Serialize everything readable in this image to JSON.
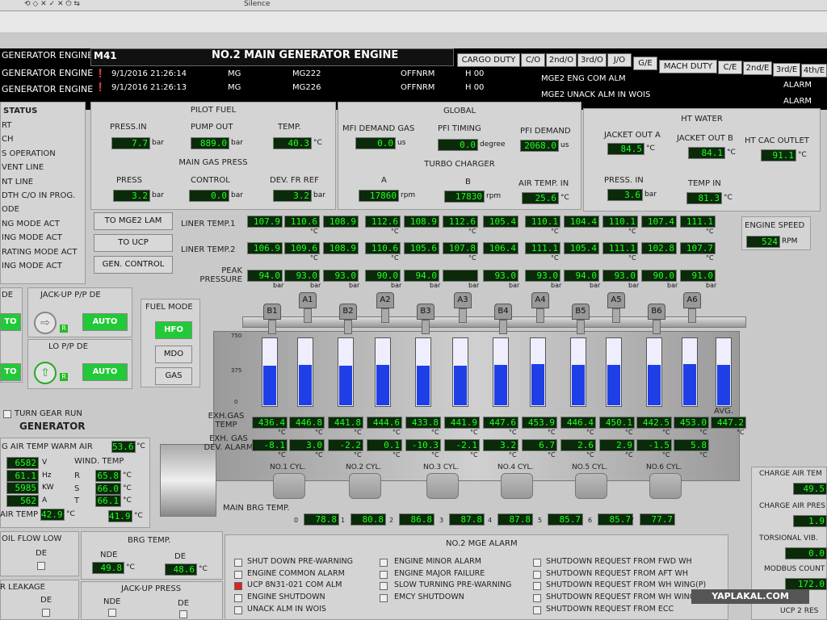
{
  "toolbar": {
    "silence": "Silence"
  },
  "header": {
    "engine_id": "M41",
    "title": "NO.2 MAIN GENERATOR ENGINE",
    "left_rows": [
      "GENERATOR ENGINE",
      "GENERATOR ENGINE",
      "GENERATOR ENGINE"
    ],
    "alarms": [
      {
        "time": "9/1/2016 21:26:14",
        "grp": "MG",
        "tag": "MG222",
        "state": "OFFNRM",
        "h": "H 00",
        "msg": "MGE2 ENG COM ALM",
        "status": "ALARM"
      },
      {
        "time": "9/1/2016 21:26:13",
        "grp": "MG",
        "tag": "MG226",
        "state": "OFFNRM",
        "h": "H 00",
        "msg": "MGE2 UNACK ALM IN WOIS",
        "status": "ALARM"
      }
    ],
    "tabs1": [
      "CARGO DUTY",
      "C/O",
      "2nd/O",
      "3rd/O",
      "J/O",
      "G/E"
    ],
    "tabs2": [
      "MACH DUTY",
      "C/E",
      "2nd/E",
      "3rd/E",
      "4th/E"
    ]
  },
  "left": {
    "status_title": "STATUS",
    "items": [
      "RT",
      "CH",
      "S OPERATION",
      "VENT LINE",
      "NT LINE",
      "DTH C/O IN PROG.",
      "ODE",
      "NG MODE ACT",
      "ING MODE ACT",
      "RATING MODE ACT",
      "ING MODE ACT"
    ],
    "de": "DE",
    "jackup_title": "JACK-UP P/P DE",
    "lo_title": "LO P/P DE",
    "auto": "AUTO",
    "to": "TO",
    "r": "R",
    "turn_gear": "TURN GEAR RUN",
    "generator": "GENERATOR",
    "air_temp_warm": "G AIR TEMP WARM AIR",
    "air_temp_warm_val": "53.6",
    "gen_vals": [
      {
        "v": "6582",
        "u": "V"
      },
      {
        "v": "61.1",
        "u": "Hz"
      },
      {
        "v": "5985",
        "u": "KW"
      },
      {
        "v": "562",
        "u": "A"
      }
    ],
    "wind_title": "WIND. TEMP",
    "wind": [
      {
        "p": "R",
        "v": "65.8"
      },
      {
        "p": "S",
        "v": "66.0"
      },
      {
        "p": "T",
        "v": "66.1"
      }
    ],
    "air_temp": "AIR TEMP",
    "air_temp_a": "42.9",
    "air_temp_b": "41.9",
    "oil_flow": "OIL FLOW LOW",
    "brg_temp": "BRG TEMP.",
    "nde": "NDE",
    "brg_nde": "49.8",
    "brg_de": "48.6",
    "leakage": "R LEAKAGE",
    "jackup_press": "JACK-UP PRESS",
    "c": "°C"
  },
  "pilot": {
    "title": "PILOT FUEL",
    "press_lbl": "PRESS.IN",
    "press": "7.7",
    "pump_lbl": "PUMP OUT",
    "pump": "889.0",
    "temp_lbl": "TEMP.",
    "temp": "40.3",
    "gas_title": "MAIN GAS PRESS",
    "gpress_lbl": "PRESS",
    "gpress": "3.2",
    "ctrl_lbl": "CONTROL",
    "ctrl": "0.0",
    "dev_lbl": "DEV. FR REF",
    "dev": "3.2",
    "bar": "bar",
    "c": "°C"
  },
  "global": {
    "title": "GLOBAL",
    "mfi_lbl": "MFI DEMAND GAS",
    "mfi": "0.0",
    "us": "us",
    "pfi_lbl": "PFI TIMING",
    "pfi": "0.0",
    "degree": "degree",
    "pfid_lbl": "PFI DEMAND",
    "pfid": "2068.0",
    "tc_title": "TURBO CHARGER",
    "a_lbl": "A",
    "a": "17860",
    "b_lbl": "B",
    "b": "17830",
    "rpm": "rpm",
    "air_lbl": "AIR TEMP. IN",
    "air": "25.6"
  },
  "ht": {
    "title": "HT WATER",
    "ja_lbl": "JACKET OUT A",
    "ja": "84.5",
    "jb_lbl": "JACKET OUT B",
    "jb": "84.1",
    "cac_lbl": "HT CAC OUTLET",
    "cac": "91.1",
    "press_lbl": "PRESS. IN",
    "press": "3.6",
    "tin_lbl": "TEMP IN",
    "tin": "81.3"
  },
  "ctrl_buttons": [
    "TO MGE2 LAM",
    "TO UCP",
    "GEN. CONTROL"
  ],
  "fuel": {
    "title": "FUEL MODE",
    "modes": [
      "HFO",
      "MDO",
      "GAS"
    ]
  },
  "engine_speed": {
    "title": "ENGINE SPEED",
    "value": "524",
    "unit": "RPM"
  },
  "liner": {
    "l1": "LINER TEMP.1",
    "l2": "LINER TEMP.2",
    "pk": "PEAK PRESSURE",
    "t1": [
      "107.9",
      "110.6",
      "108.9",
      "112.6",
      "108.9",
      "112.6",
      "105.4",
      "110.1",
      "104.4",
      "110.1",
      "107.4",
      "111.1"
    ],
    "t2": [
      "106.9",
      "109.6",
      "108.9",
      "110.6",
      "105.6",
      "107.8",
      "106.4",
      "111.1",
      "105.4",
      "111.1",
      "102.8",
      "107.7"
    ],
    "pp": [
      "94.0",
      "93.0",
      "93.0",
      "90.0",
      "94.0",
      "",
      "93.0",
      "93.0",
      "94.0",
      "93.0",
      "90.0",
      "91.0"
    ],
    "c": "°C",
    "bar": "bar"
  },
  "cyl_labels": [
    "B1",
    "A1",
    "B2",
    "A2",
    "B3",
    "A3",
    "B4",
    "A4",
    "B5",
    "A5",
    "B6",
    "A6"
  ],
  "exh": {
    "scale": [
      "750",
      "375",
      "0"
    ],
    "levels": [
      436.4,
      446.8,
      441.8,
      444.6,
      433.8,
      441.9,
      447.6,
      453.9,
      446.4,
      450.1,
      442.5,
      453.0,
      447.2
    ],
    "max": 750,
    "temp_lbl": "EXH.GAS TEMP",
    "dev_lbl": "EXH. GAS DEV. ALARM",
    "avg": "AVG.",
    "temps": [
      "436.4",
      "446.8",
      "441.8",
      "444.6",
      "433.8",
      "441.9",
      "447.6",
      "453.9",
      "446.4",
      "450.1",
      "442.5",
      "453.0",
      "447.2"
    ],
    "devs": [
      "-8.1",
      "3.0",
      "-2.2",
      "0.1",
      "-10.3",
      "-2.1",
      "3.2",
      "6.7",
      "2.6",
      "2.9",
      "-1.5",
      "5.8"
    ]
  },
  "cyls": [
    "NO.1 CYL.",
    "NO.2 CYL.",
    "NO.3 CYL.",
    "NO.4 CYL.",
    "NO.5 CYL.",
    "NO.6 CYL."
  ],
  "brg": {
    "title": "MAIN BRG TEMP.",
    "idx": [
      "0",
      "1",
      "2",
      "3",
      "4",
      "5",
      "6",
      "7"
    ],
    "vals": [
      "78.8",
      "80.8",
      "86.8",
      "87.8",
      "87.8",
      "85.7",
      "85.7",
      "77.7"
    ]
  },
  "mge_alarm": {
    "title": "NO.2 MGE ALARM",
    "col1": [
      "SHUT DOWN PRE-WARNING",
      "ENGINE COMMON ALARM",
      "UCP 8N31-021 COM ALM",
      "ENGINE SHUTDOWN",
      "UNACK ALM IN WOIS"
    ],
    "col2": [
      "ENGINE MINOR ALARM",
      "ENGINE MAJOR FAILURE",
      "SLOW TURNING PRE-WARNING",
      "EMCY SHUTDOWN"
    ],
    "col3": [
      "SHUTDOWN REQUEST FROM FWD WH",
      "SHUTDOWN REQUEST FROM AFT WH",
      "SHUTDOWN REQUEST FROM WH WING(P)",
      "SHUTDOWN REQUEST FROM WH WING",
      "SHUTDOWN REQUEST FROM ECC"
    ]
  },
  "right": {
    "charge1": "CHARGE AIR TEM",
    "charge1_val": "49.5",
    "charge2": "CHARGE AIR PRES",
    "charge2_val": "1.9",
    "torsional": "TORSIONAL VIB.",
    "torsional_val": "0.0",
    "modbus": "MODBUS COUNT",
    "modbus_val": "172.0",
    "ucp2": "UCP 2 RES"
  },
  "watermark": "YAPLAKAL.COM"
}
